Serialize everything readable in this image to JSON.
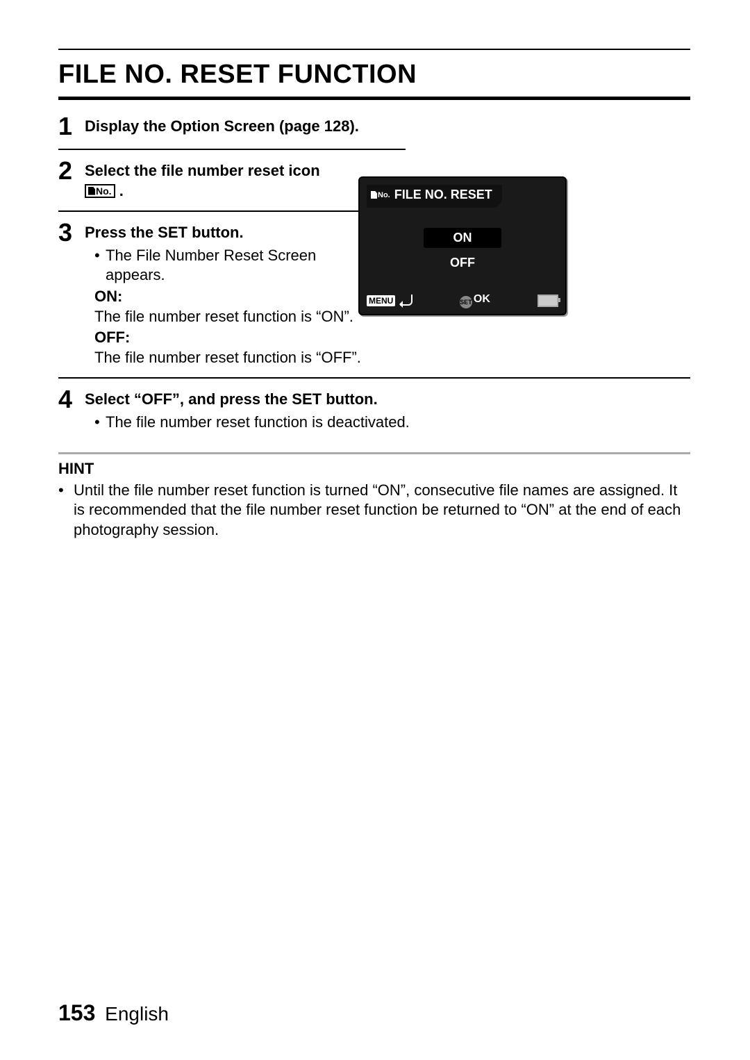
{
  "title": "FILE NO. RESET FUNCTION",
  "steps": [
    {
      "num": "1",
      "heading": "Display the Option Screen (page 128)."
    },
    {
      "num": "2",
      "heading_pre": "Select the file number reset icon ",
      "icon_text": "No.",
      "heading_post": "."
    },
    {
      "num": "3",
      "heading": "Press the SET button.",
      "bullet": "The File Number Reset Screen appears.",
      "defs": [
        {
          "label": "ON:",
          "text": "The file number reset function is “ON”."
        },
        {
          "label": "OFF:",
          "text": "The file number reset function is “OFF”."
        }
      ]
    },
    {
      "num": "4",
      "heading": "Select “OFF”, and press the SET button.",
      "bullet": "The file number reset function is deactivated."
    }
  ],
  "lcd": {
    "icon_text": "No.",
    "title": "FILE NO. RESET",
    "opt_on": "ON",
    "opt_off": "OFF",
    "menu_label": "MENU",
    "set_label": "SET",
    "ok_label": "OK"
  },
  "hint": {
    "title": "HINT",
    "text": "Until the file number reset function is turned “ON”, consecutive file names are assigned. It is recommended that the file number reset function be returned to “ON” at the end of each photography session."
  },
  "footer": {
    "page": "153",
    "lang": "English"
  }
}
